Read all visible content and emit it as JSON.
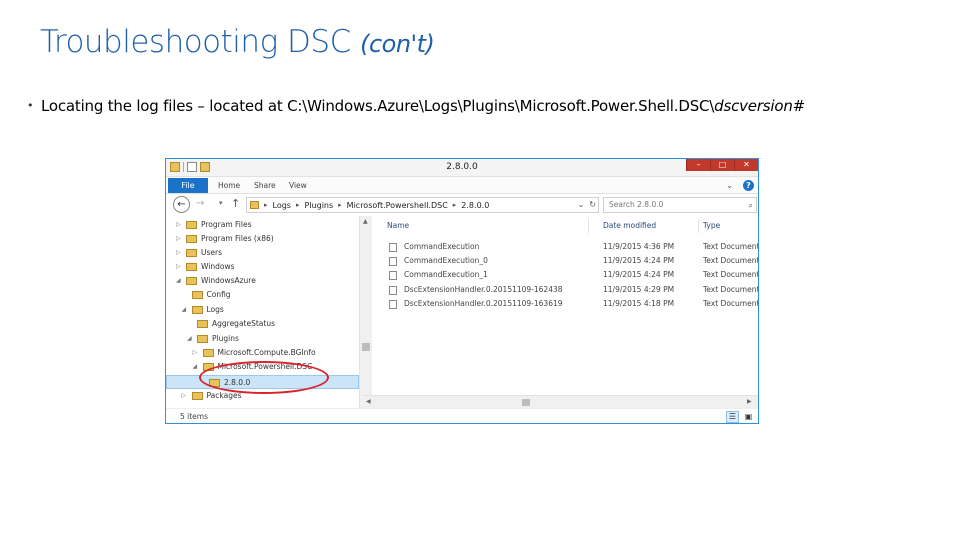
{
  "slide": {
    "title": "Troubleshooting DSC",
    "title_suffix": "(con't)",
    "bullet_prefix": "Locating the log files – located at C:\\Windows.Azure\\Logs\\Plugins\\Microsoft.Power.Shell.DSC\\",
    "bullet_italic": "dscversion#"
  },
  "window": {
    "title": "2.8.0.0",
    "ribbon": {
      "file": "File",
      "tabs": [
        "Home",
        "Share",
        "View"
      ]
    },
    "address_parts": [
      "Logs",
      "Plugins",
      "Microsoft.Powershell.DSC",
      "2.8.0.0"
    ],
    "search_placeholder": "Search 2.8.0.0",
    "columns": [
      "Name",
      "Date modified",
      "Type"
    ],
    "tree": [
      {
        "label": "Program Files",
        "depth": 0,
        "caret": "▷"
      },
      {
        "label": "Program Files (x86)",
        "depth": 0,
        "caret": "▷"
      },
      {
        "label": "Users",
        "depth": 0,
        "caret": "▷"
      },
      {
        "label": "Windows",
        "depth": 0,
        "caret": "▷"
      },
      {
        "label": "WindowsAzure",
        "depth": 0,
        "caret": "◢"
      },
      {
        "label": "Config",
        "depth": 1,
        "caret": ""
      },
      {
        "label": "Logs",
        "depth": 1,
        "caret": "◢"
      },
      {
        "label": "AggregateStatus",
        "depth": 2,
        "caret": ""
      },
      {
        "label": "Plugins",
        "depth": 2,
        "caret": "◢"
      },
      {
        "label": "Microsoft.Compute.BGInfo",
        "depth": 3,
        "caret": "▷"
      },
      {
        "label": "Microsoft.Powershell.DSC",
        "depth": 3,
        "caret": "◢"
      },
      {
        "label": "2.8.0.0",
        "depth": 4,
        "caret": "",
        "selected": true
      },
      {
        "label": "Packages",
        "depth": 1,
        "caret": "▷"
      }
    ],
    "files": [
      {
        "name": "CommandExecution",
        "date": "11/9/2015 4:36 PM",
        "type": "Text Document"
      },
      {
        "name": "CommandExecution_0",
        "date": "11/9/2015 4:24 PM",
        "type": "Text Document"
      },
      {
        "name": "CommandExecution_1",
        "date": "11/9/2015 4:24 PM",
        "type": "Text Document"
      },
      {
        "name": "DscExtensionHandler.0.20151109-162438",
        "date": "11/9/2015 4:29 PM",
        "type": "Text Document"
      },
      {
        "name": "DscExtensionHandler.0.20151109-163619",
        "date": "11/9/2015 4:18 PM",
        "type": "Text Document"
      }
    ],
    "status": "5 items",
    "colors": {
      "accent": "#1a73c8",
      "title": "#1f5fa9",
      "highlight": "#d9222a",
      "close": "#c0392b"
    }
  }
}
